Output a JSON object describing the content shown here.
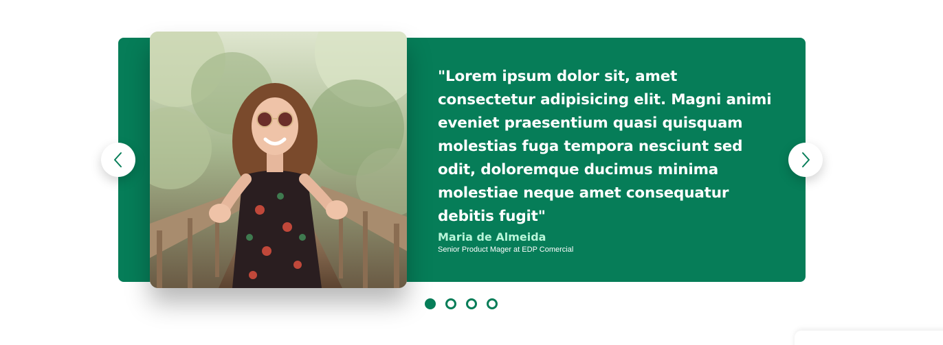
{
  "testimonial": {
    "quote": "\"Lorem ipsum dolor sit, amet consectetur adipisicing elit. Magni animi eveniet praesentium quasi quisquam molestias fuga tempora nesciunt sed odit, doloremque ducimus minima molestiae neque amet consequatur debitis fugit\"",
    "author_name": "Maria de Almeida",
    "author_role": "Senior Product Mager at EDP Comercial"
  },
  "navigation": {
    "prev_icon": "chevron-left-icon",
    "next_icon": "chevron-right-icon"
  },
  "pagination": {
    "total": 4,
    "active_index": 0
  },
  "colors": {
    "accent": "#067d58",
    "author_name": "#b8f5d9"
  }
}
